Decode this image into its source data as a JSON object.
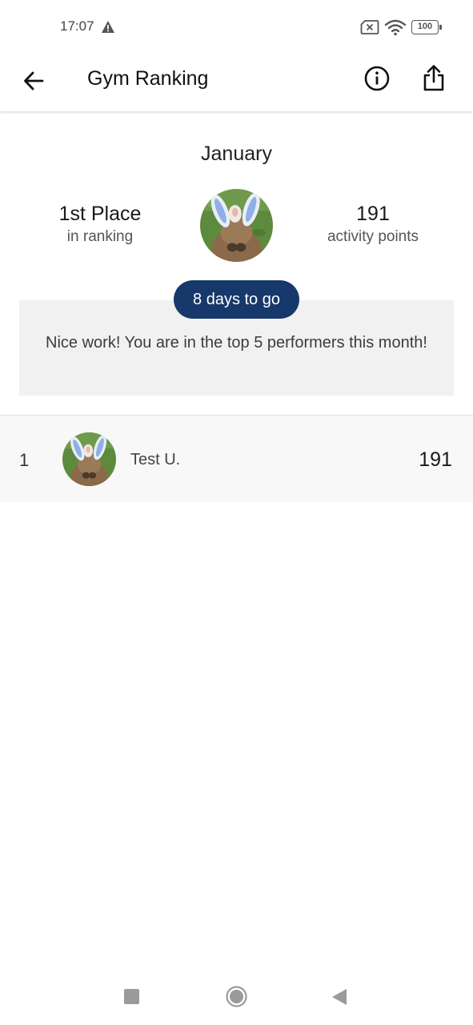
{
  "status_bar": {
    "time": "17:07",
    "battery": "100"
  },
  "app_bar": {
    "title": "Gym Ranking",
    "icons": [
      "back-arrow-icon",
      "info-icon",
      "share-icon"
    ]
  },
  "summary": {
    "month": "January",
    "place": "1st Place",
    "place_caption": "in ranking",
    "points": "191",
    "points_caption": "activity points",
    "days_left": "8 days to go",
    "message": "Nice work! You are in the top 5 performers this month!"
  },
  "ranking": {
    "rows": [
      {
        "rank": "1",
        "name": "Test U.",
        "score": "191"
      }
    ]
  },
  "colors": {
    "accent": "#17386a",
    "message_bg": "#f1f1f1",
    "row_bg": "#f8f8f8"
  }
}
